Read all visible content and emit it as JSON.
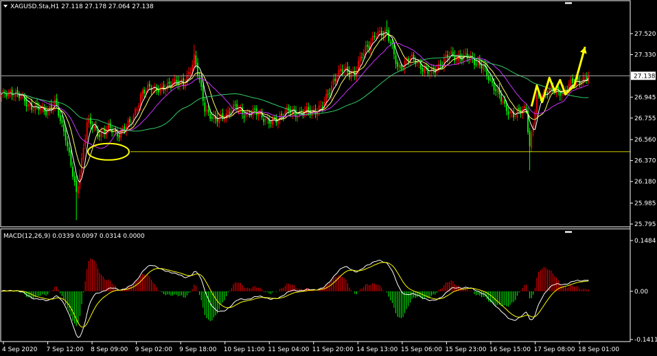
{
  "header": {
    "symbol_info": "XAGUSD.Sta,H1  27.118 27.178 27.064 27.138",
    "indicator_info": "MACD(12,26,9) 0.0339 0.0097 0.0314 0.0000"
  },
  "colors": {
    "background": "#000000",
    "bull": "#ff0000",
    "bear": "#00ff00",
    "ma_fast": "#ffffff",
    "ma_mid": "#ffff66",
    "ma_slow": "#cc33ff",
    "ma_long": "#33cc66",
    "annotation": "#ffff00",
    "price_line": "#b0b0b0",
    "macd_main": "#ffffff",
    "macd_signal": "#ffff00"
  },
  "chart_data": [
    {
      "type": "candlestick",
      "symbol": "XAGUSD.Sta",
      "timeframe": "H1",
      "current_price": 27.138,
      "ohlc_last": {
        "open": 27.118,
        "high": 27.178,
        "low": 27.064,
        "close": 27.138
      },
      "y_ticks": [
        "27.520",
        "27.330",
        "27.138",
        "26.945",
        "26.755",
        "26.560",
        "26.370",
        "26.180",
        "25.985",
        "25.795"
      ],
      "ylim": [
        25.795,
        27.7
      ],
      "x_ticks": [
        "4 Sep 2020",
        "7 Sep 12:00",
        "8 Sep 09:00",
        "9 Sep 02:00",
        "9 Sep 18:00",
        "10 Sep 11:00",
        "11 Sep 04:00",
        "11 Sep 20:00",
        "14 Sep 13:00",
        "15 Sep 06:00",
        "15 Sep 23:00",
        "16 Sep 15:00",
        "17 Sep 08:00",
        "18 Sep 01:00"
      ],
      "support_level": 26.45,
      "anchors": [
        [
          0,
          26.95
        ],
        [
          6,
          27.0
        ],
        [
          12,
          26.92
        ],
        [
          18,
          26.85
        ],
        [
          24,
          26.82
        ],
        [
          30,
          26.88
        ],
        [
          36,
          26.6
        ],
        [
          42,
          26.05
        ],
        [
          48,
          26.72
        ],
        [
          54,
          26.62
        ],
        [
          60,
          26.65
        ],
        [
          66,
          26.62
        ],
        [
          72,
          26.7
        ],
        [
          78,
          26.95
        ],
        [
          84,
          27.05
        ],
        [
          90,
          27.0
        ],
        [
          96,
          27.1
        ],
        [
          102,
          27.05
        ],
        [
          108,
          27.3
        ],
        [
          114,
          26.85
        ],
        [
          120,
          26.72
        ],
        [
          126,
          26.8
        ],
        [
          132,
          26.85
        ],
        [
          138,
          26.78
        ],
        [
          144,
          26.82
        ],
        [
          150,
          26.7
        ],
        [
          156,
          26.78
        ],
        [
          162,
          26.82
        ],
        [
          168,
          26.8
        ],
        [
          174,
          26.82
        ],
        [
          180,
          26.85
        ],
        [
          186,
          27.1
        ],
        [
          192,
          27.2
        ],
        [
          198,
          27.15
        ],
        [
          204,
          27.4
        ],
        [
          210,
          27.5
        ],
        [
          216,
          27.55
        ],
        [
          222,
          27.2
        ],
        [
          228,
          27.3
        ],
        [
          234,
          27.25
        ],
        [
          240,
          27.15
        ],
        [
          246,
          27.25
        ],
        [
          252,
          27.33
        ],
        [
          258,
          27.3
        ],
        [
          264,
          27.3
        ],
        [
          270,
          27.2
        ],
        [
          276,
          27.05
        ],
        [
          282,
          26.85
        ],
        [
          288,
          26.78
        ],
        [
          294,
          26.85
        ],
        [
          296,
          26.5
        ],
        [
          300,
          26.92
        ],
        [
          306,
          27.02
        ],
        [
          312,
          26.98
        ],
        [
          318,
          27.05
        ],
        [
          324,
          27.1
        ],
        [
          329,
          27.138
        ]
      ],
      "annotation": {
        "circle_at": {
          "index": 60,
          "price": 26.45
        },
        "arrow_path": [
          [
            297,
            26.86
          ],
          [
            300,
            27.05
          ],
          [
            303,
            26.9
          ],
          [
            307,
            27.12
          ],
          [
            310,
            27.0
          ],
          [
            313,
            27.1
          ],
          [
            316,
            26.97
          ],
          [
            321,
            27.05
          ],
          [
            327,
            27.4
          ]
        ]
      }
    },
    {
      "type": "macd",
      "params": [
        12,
        26,
        9
      ],
      "values": {
        "main": 0.0339,
        "signal": 0.0097,
        "histogram": 0.0314,
        "zero": 0.0
      },
      "y_ticks": [
        "0.1484",
        "0.00",
        "-0.1411"
      ],
      "ylim": [
        -0.1411,
        0.1484
      ]
    }
  ]
}
